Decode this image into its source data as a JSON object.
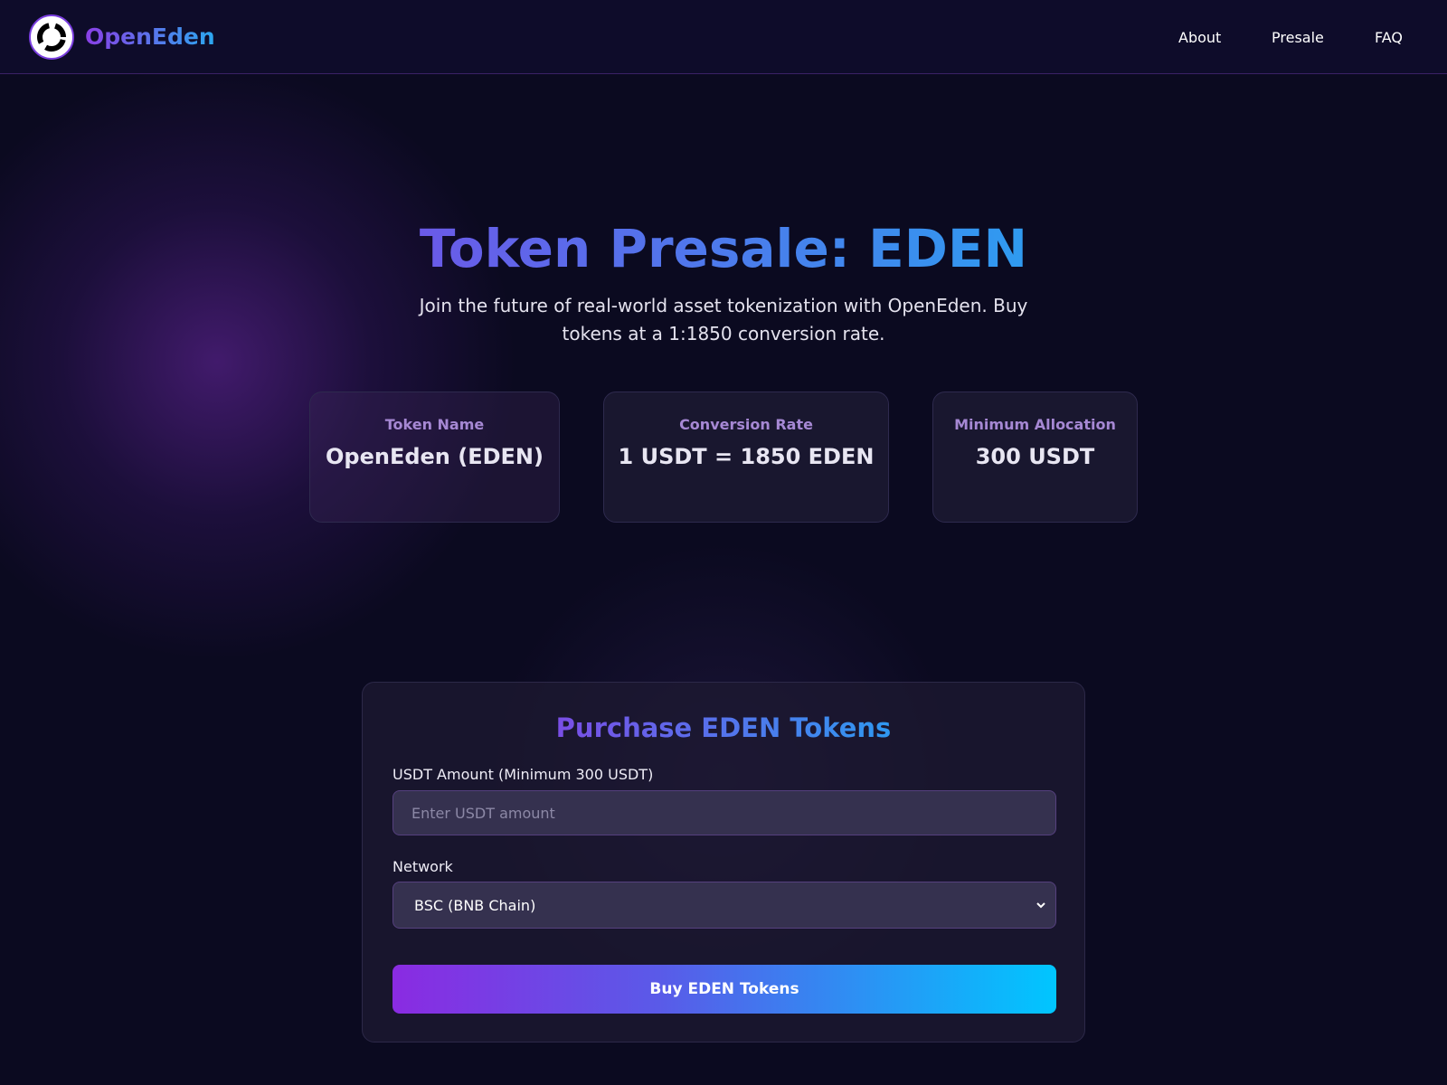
{
  "header": {
    "brand": "OpenEden",
    "logo_icon": "openeden-logo-icon",
    "nav": [
      {
        "label": "About"
      },
      {
        "label": "Presale"
      },
      {
        "label": "FAQ"
      }
    ]
  },
  "hero": {
    "title": "Token Presale: EDEN",
    "subtitle": "Join the future of real-world asset tokenization with OpenEden. Buy tokens at a 1:1850 conversion rate."
  },
  "info_cards": [
    {
      "label": "Token Name",
      "value": "OpenEden (EDEN)"
    },
    {
      "label": "Conversion Rate",
      "value": "1 USDT = 1850 EDEN"
    },
    {
      "label": "Minimum Allocation",
      "value": "300 USDT"
    }
  ],
  "purchase": {
    "title": "Purchase EDEN Tokens",
    "amount_label": "USDT Amount (Minimum 300 USDT)",
    "amount_value": "",
    "amount_placeholder": "Enter USDT amount",
    "network_label": "Network",
    "network_selected": "BSC (BNB Chain)",
    "buy_label": "Buy EDEN Tokens"
  },
  "colors": {
    "background": "#0b0a20",
    "header_bg": "#0e0c2a",
    "accent_purple": "#8a2be2",
    "accent_blue": "#00c6ff",
    "card_label": "#a688d4"
  }
}
